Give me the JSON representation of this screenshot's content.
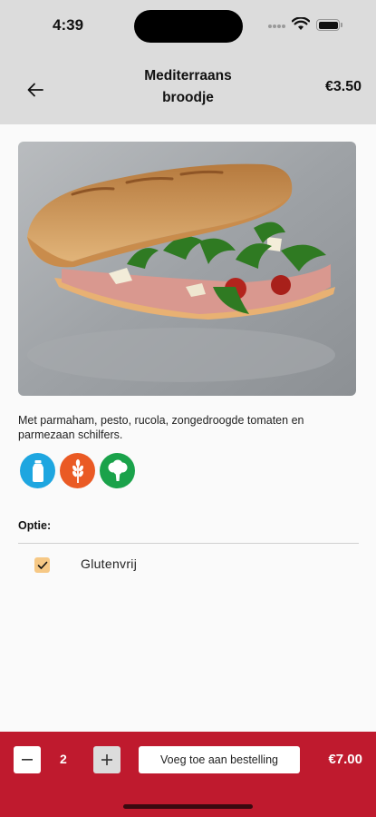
{
  "status_bar": {
    "time": "4:39"
  },
  "header": {
    "title_line1": "Mediterraans",
    "title_line2": "broodje",
    "price": "€3.50",
    "back_icon": "arrow-left-icon"
  },
  "product": {
    "description": "Met parmaham, pesto, rucola, zongedroogde tomaten en parmezaan schilfers.",
    "allergens": [
      {
        "icon": "milk-bottle-icon",
        "color": "#1ea6e0"
      },
      {
        "icon": "wheat-icon",
        "color": "#ea5a24"
      },
      {
        "icon": "broccoli-icon",
        "color": "#1aa24a"
      }
    ]
  },
  "options": {
    "label": "Optie:",
    "items": [
      {
        "label": "Glutenvrij",
        "checked": true
      }
    ]
  },
  "order_bar": {
    "quantity": "2",
    "minus_label": "−",
    "plus_label": "+",
    "add_label": "Voeg toe aan bestelling",
    "total": "€7.00"
  },
  "colors": {
    "header_bg": "#dcdcdc",
    "accent_red": "#bf1a2e",
    "checkbox": "#f6c885"
  }
}
